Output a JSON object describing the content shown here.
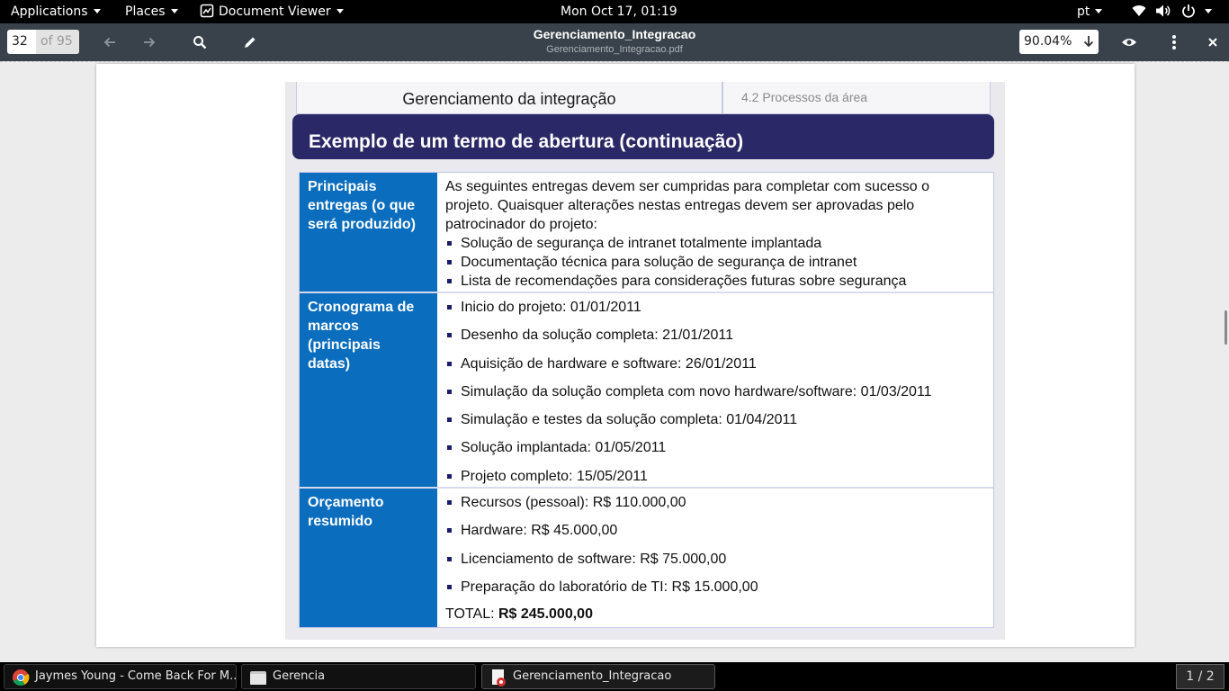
{
  "top_panel": {
    "applications": "Applications",
    "places": "Places",
    "app_name": "Document Viewer",
    "clock": "Mon Oct 17, 01:19",
    "keyboard_layout": "pt"
  },
  "header": {
    "page_current": "32",
    "page_total": "of 95",
    "title": "Gerenciamento_Integracao",
    "subtitle": "Gerenciamento_Integracao.pdf",
    "zoom": "90.04%"
  },
  "slide": {
    "tab_left": "Gerenciamento da integração",
    "tab_right": "4.2 Processos da área",
    "title": "Exemplo de um termo de abertura (continuação)",
    "rows": [
      {
        "label": [
          "Principais",
          "entregas (o que",
          "será produzido)"
        ],
        "intro": [
          "As seguintes entregas devem ser cumpridas para completar com sucesso o",
          "projeto. Quaisquer alterações nestas entregas devem ser aprovadas pelo",
          "patrocinador do projeto:"
        ],
        "bullets": [
          "Solução de segurança de intranet totalmente implantada",
          "Documentação técnica para solução de segurança de intranet",
          "Lista de recomendações para considerações futuras sobre segurança"
        ]
      },
      {
        "label": [
          "Cronograma de",
          "marcos",
          "(principais",
          "datas)"
        ],
        "bullets": [
          "Inicio do projeto: 01/01/2011",
          "Desenho da solução completa: 21/01/2011",
          "Aquisição de hardware e software: 26/01/2011",
          "Simulação da solução completa com novo hardware/software: 01/03/2011",
          "Simulação e testes da solução completa: 01/04/2011",
          "Solução implantada: 01/05/2011",
          "Projeto completo: 15/05/2011"
        ]
      },
      {
        "label": [
          "Orçamento",
          "resumido"
        ],
        "bullets": [
          "Recursos (pessoal): R$ 110.000,00",
          "Hardware: R$ 45.000,00",
          "Licenciamento de software: R$ 75.000,00",
          "Preparação do laboratório de TI: R$ 15.000,00"
        ],
        "total_label": "TOTAL:",
        "total_value": "R$ 245.000,00"
      }
    ]
  },
  "taskbar": {
    "tasks": [
      "Jaymes Young - Come Back For M...",
      "Gerencia",
      "Gerenciamento_Integracao"
    ],
    "workspace": "1 / 2"
  },
  "icons": [
    "back-arrow-icon",
    "forward-arrow-icon",
    "search-icon",
    "annotate-pen-icon",
    "zoom-dropdown-icon",
    "view-eye-icon",
    "menu-kebab-icon",
    "close-icon",
    "wifi-icon",
    "volume-icon",
    "power-icon",
    "chrome-icon",
    "folder-icon",
    "pdf-viewer-icon"
  ],
  "colors": {
    "header_bg": "#39424a",
    "slide_title_bg": "#2a2866",
    "label_bg": "#0b6dbd"
  }
}
